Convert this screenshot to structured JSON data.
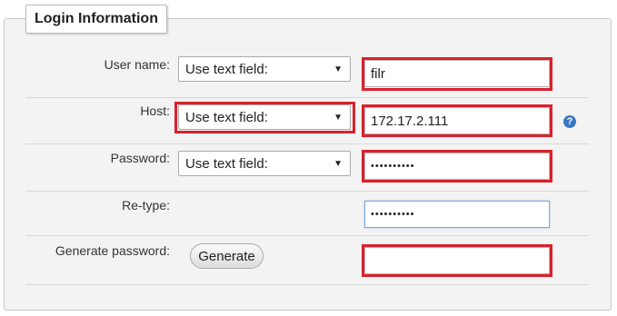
{
  "section": {
    "title": "Login Information"
  },
  "fields": {
    "username": {
      "label": "User name:",
      "select": "Use text field:",
      "value": "filr"
    },
    "host": {
      "label": "Host:",
      "select": "Use text field:",
      "value": "172.17.2.111",
      "help_icon": "question-circle-icon",
      "help_glyph": "?"
    },
    "password": {
      "label": "Password:",
      "select": "Use text field:",
      "value": "••••••••••"
    },
    "retype": {
      "label": "Re-type:",
      "value": "••••••••••"
    },
    "generate": {
      "label": "Generate password:",
      "button": "Generate",
      "value": ""
    }
  },
  "icons": {
    "dropdown": "▼"
  },
  "colors": {
    "highlight": "#d9202e",
    "accent": "#3a78c2",
    "panel_bg": "#f3f3f3"
  }
}
